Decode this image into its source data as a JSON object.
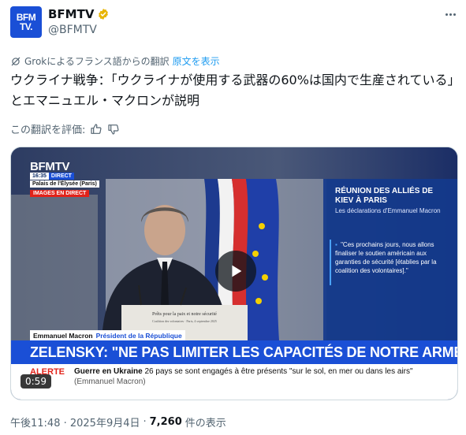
{
  "author": {
    "avatar_text_line1": "BFM",
    "avatar_text_line2": "TV.",
    "display_name": "BFMTV",
    "handle": "@BFMTV",
    "brand_color": "#1a4fd6",
    "verified_color": "#e8b400"
  },
  "translation": {
    "note": "Grokによるフランス語からの翻訳",
    "show_original": "原文を表示",
    "icon": "grok-icon"
  },
  "tweet": {
    "text": "ウクライナ戦争：「ウクライナが使用する武器の60%は国内で生産されている」とエマニュエル・マクロンが説明"
  },
  "rate": {
    "label": "この翻訳を評価:"
  },
  "video": {
    "duration": "0:59",
    "channel_logo": "BFMTV",
    "direct_time": "16:35",
    "direct_label": "DIRECT",
    "place": "Palais de l'Élysée (Paris)",
    "live_images": "IMAGES EN DIRECT",
    "panel_title": "RÉUNION DES ALLIÉS DE KIEV À PARIS",
    "panel_subtitle": "Les déclarations d'Emmanuel Macron",
    "panel_quote": "\"Ces prochains jours, nous allons finaliser le soutien américain aux garanties de sécurité [établies par la coalition des volontaires].\"",
    "podium_line1": "Prêts pour la paix et notre sécurité",
    "podium_line2": "Coalition des volontaires · Paris, 4 septembre 2025",
    "speaker_name": "Emmanuel Macron",
    "speaker_title": "Président de la République",
    "headline": "ZELENSKY: \"NE PAS LIMITER LES CAPACITÉS DE NOTRE ARMÉE\"",
    "ticker_alert": "ALERTE",
    "ticker_topic": "Guerre en Ukraine",
    "ticker_body": "26 pays se sont engagés à être présents \"sur le sol, en mer ou dans les airs\"",
    "ticker_attribution": "(Emmanuel Macron)"
  },
  "footer": {
    "timestamp": "午後11:48 · 2025年9月4日",
    "separator": "·",
    "views_count": "7,260",
    "views_label": "件の表示"
  }
}
